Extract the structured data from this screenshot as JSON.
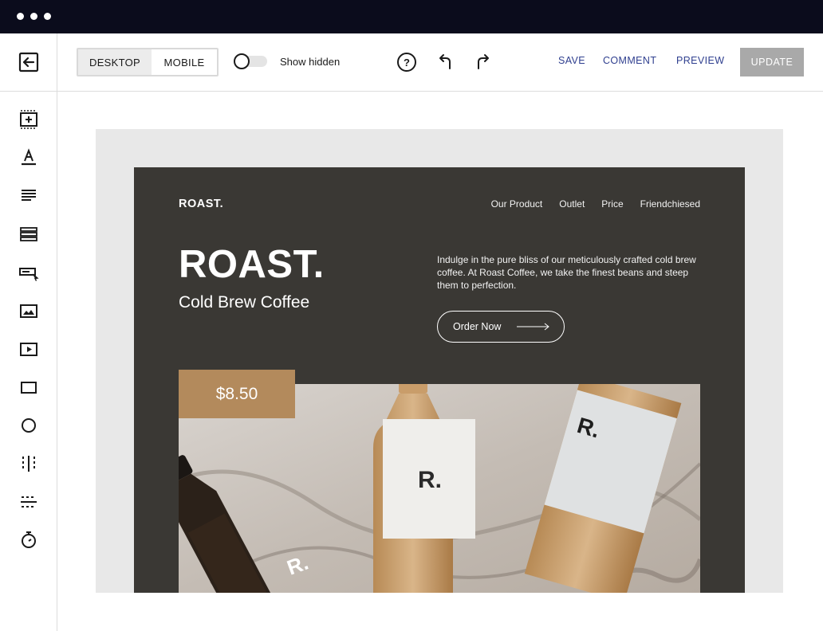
{
  "editor": {
    "device_toggle": {
      "desktop": "DESKTOP",
      "mobile": "MOBILE",
      "selected": "DESKTOP"
    },
    "show_hidden": {
      "label": "Show hidden",
      "enabled": false
    },
    "actions": {
      "save": "SAVE",
      "comment": "COMMENT",
      "preview": "PREVIEW",
      "update": "UPDATE"
    },
    "toolbar_icons": [
      "back-arrow-icon",
      "help-icon",
      "undo-icon",
      "redo-icon"
    ],
    "sidebar_tools": [
      "add-section-icon",
      "heading-text-icon",
      "paragraph-icon",
      "list-block-icon",
      "button-element-icon",
      "image-icon",
      "video-icon",
      "rectangle-icon",
      "circle-icon",
      "column-divider-icon",
      "horizontal-divider-icon",
      "timer-icon"
    ]
  },
  "site": {
    "logo": "ROAST.",
    "nav": [
      "Our Product",
      "Outlet",
      "Price",
      "Friendchiesed"
    ],
    "hero_title": "ROAST.",
    "hero_subtitle": "Cold Brew Coffee",
    "description": "Indulge in the pure bliss of our meticulously crafted cold brew coffee. At Roast Coffee, we take the finest beans and steep them to perfection.",
    "cta": "Order Now",
    "price": "$8.50",
    "bottle_label": "R."
  },
  "colors": {
    "titlebar": "#0b0c1c",
    "hero_bg": "#3a3834",
    "price_badge": "#b38a5c",
    "link": "#2f3f8f",
    "update_button": "#a9a9a9"
  }
}
